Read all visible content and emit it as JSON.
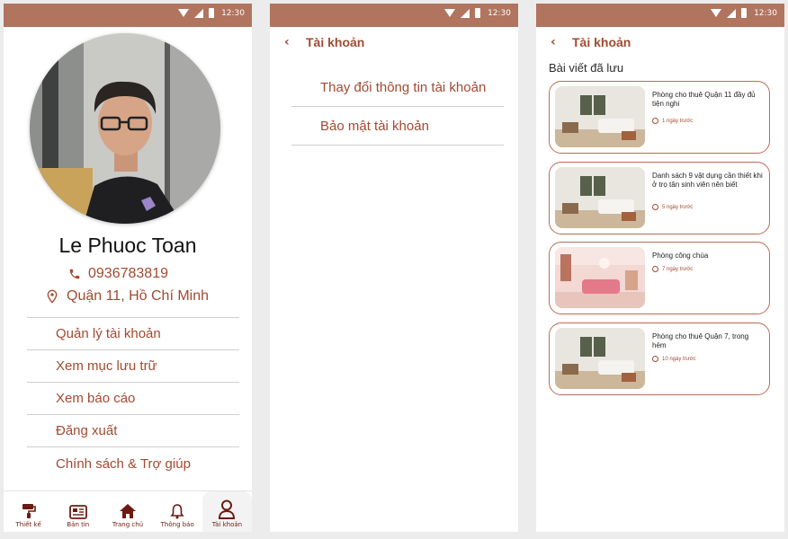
{
  "status_time": "12:30",
  "profile": {
    "name": "Le Phuoc Toan",
    "phone": "0936783819",
    "address": "Quận 11, Hồ Chí Minh",
    "menu": [
      "Quản lý tài khoản",
      "Xem mục lưu trữ",
      "Xem báo cáo",
      "Đăng xuất",
      "Chính sách & Trợ giúp"
    ],
    "nav": [
      {
        "label": "Thiết kế",
        "icon": "paint-roller-icon"
      },
      {
        "label": "Bản tin",
        "icon": "newspaper-icon"
      },
      {
        "label": "Trang chủ",
        "icon": "home-icon"
      },
      {
        "label": "Thông báo",
        "icon": "bell-icon"
      },
      {
        "label": "Tài khoản",
        "icon": "user-icon"
      }
    ]
  },
  "account": {
    "title": "Tài khoản",
    "options": [
      "Thay đổi thông tin tài khoản",
      "Bảo mật tài khoản"
    ]
  },
  "saved": {
    "title": "Tài khoản",
    "section": "Bài viết đã lưu",
    "posts": [
      {
        "title": "Phòng cho thuê Quận 11 đầy đủ tiện nghi",
        "time": "1 ngày trước"
      },
      {
        "title": "Danh sách 9 vật dụng cần thiết khi ở trọ tân sinh viên nên biết",
        "time": "5 ngày trước"
      },
      {
        "title": "Phòng công chúa",
        "time": "7 ngày trước"
      },
      {
        "title": "Phòng cho thuê Quận 7, trong hẻm",
        "time": "10 ngày trước"
      }
    ]
  },
  "colors": {
    "accent": "#a24a31",
    "statusbar": "#b1745f",
    "nav": "#6b1b12"
  }
}
